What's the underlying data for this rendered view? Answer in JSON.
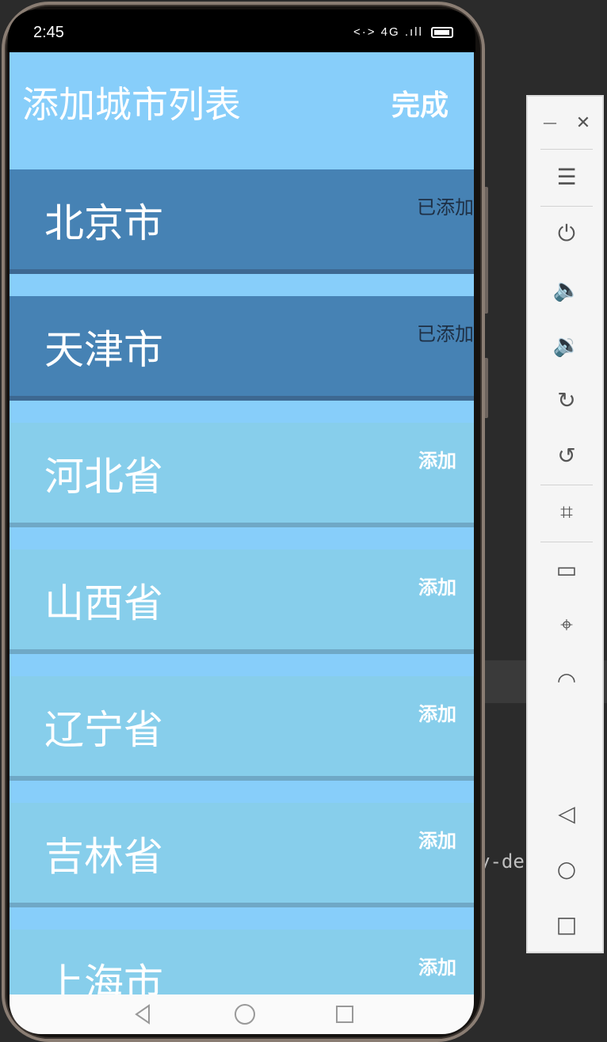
{
  "status_bar": {
    "time": "2:45",
    "network": "<·> 4G .ıll"
  },
  "header": {
    "title": "添加城市列表",
    "done_label": "完成"
  },
  "cities": [
    {
      "name": "北京市",
      "action": "已添加",
      "added": true
    },
    {
      "name": "天津市",
      "action": "已添加",
      "added": true
    },
    {
      "name": "河北省",
      "action": "添加",
      "added": false
    },
    {
      "name": "山西省",
      "action": "添加",
      "added": false
    },
    {
      "name": "辽宁省",
      "action": "添加",
      "added": false
    },
    {
      "name": "吉林省",
      "action": "添加",
      "added": false
    },
    {
      "name": "上海市",
      "action": "添加",
      "added": false
    }
  ],
  "background_text": "y-de",
  "colors": {
    "header_bg": "#87CEFA",
    "added_bg": "#4682B4",
    "open_bg": "#87CEEB"
  },
  "emulator_panel": [
    "minimize-icon",
    "close-icon",
    "menu-icon",
    "power-icon",
    "volume-up-icon",
    "volume-down-icon",
    "rotate-right-icon",
    "rotate-left-icon",
    "crop-icon",
    "battery-icon",
    "location-icon",
    "wifi-icon",
    "back-icon",
    "home-icon",
    "overview-icon"
  ]
}
